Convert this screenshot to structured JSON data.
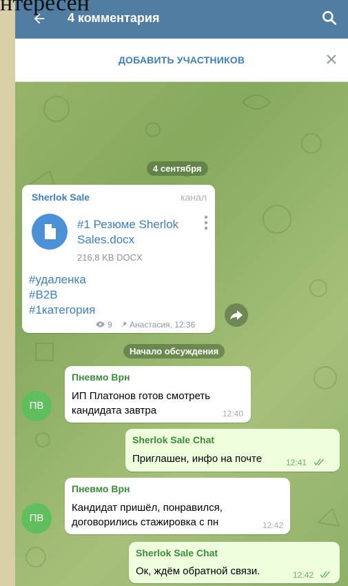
{
  "overlay_text": "нтересен",
  "header": {
    "title": "4 комментария"
  },
  "add_bar": {
    "label": "ДОБАВИТЬ УЧАСТНИКОВ"
  },
  "date_pill": "4 сентября",
  "channel_post": {
    "sender": "Sherlok Sale",
    "channel_tag": "канал",
    "file": {
      "name_line1": "#1 Резюме Sherlok",
      "name_line2": "Sales.docx",
      "size": "216,8 KB DOCX"
    },
    "tags": [
      "#удаленка",
      "#B2B",
      "#1категория"
    ],
    "views": "9",
    "author_time": "Анастасия, 12:36"
  },
  "discussion_pill": "Начало обсуждения",
  "messages": [
    {
      "sender": "Пневмо Врн",
      "avatar": "ПВ",
      "line1": "ИП Платонов готов смотреть",
      "line2": "кандидата завтра",
      "time": "12:40"
    },
    {
      "sender": "Sherlok Sale Chat",
      "text": "Приглашен, инфо на почте",
      "time": "12:41"
    },
    {
      "sender": "Пневмо Врн",
      "avatar": "ПВ",
      "line1": "Кандидат пришёл, понравился,",
      "line2": "договорились стажировка с пн",
      "time": "12:42"
    },
    {
      "sender": "Sherlok Sale Chat",
      "text": "Ок, ждём обратной связи.",
      "time": "12:42"
    }
  ],
  "colors": {
    "header": "#517da2",
    "accent": "#3d7fbf",
    "avatar": "#60be5c",
    "outgoing": "#effedd"
  }
}
